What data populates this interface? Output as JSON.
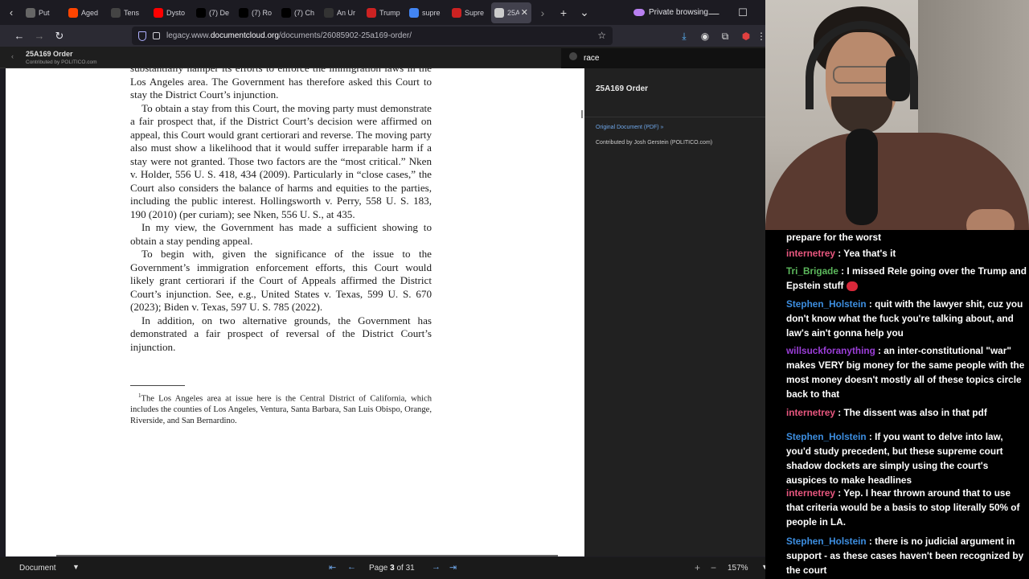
{
  "browser": {
    "tabs": [
      {
        "label": "Put",
        "icon": "generic-tab-icon",
        "color": "#666666"
      },
      {
        "label": "Aged",
        "icon": "reddit-icon",
        "color": "#ff4500"
      },
      {
        "label": "Tens",
        "icon": "generic-tab-icon",
        "color": "#444444"
      },
      {
        "label": "Dysto",
        "icon": "youtube-icon",
        "color": "#ff0000"
      },
      {
        "label": "(7) De",
        "icon": "x-icon",
        "color": "#000000"
      },
      {
        "label": "(7) Ro",
        "icon": "x-icon",
        "color": "#000000"
      },
      {
        "label": "(7) Ch",
        "icon": "x-icon",
        "color": "#000000"
      },
      {
        "label": "An Ur",
        "icon": "generic-tab-icon",
        "color": "#333333"
      },
      {
        "label": "Trump",
        "icon": "generic-tab-icon",
        "color": "#cc2222"
      },
      {
        "label": "supre",
        "icon": "google-icon",
        "color": "#4285f4"
      },
      {
        "label": "Supre",
        "icon": "generic-tab-icon",
        "color": "#cc2222"
      },
      {
        "label": "25A",
        "icon": "documentcloud-icon",
        "color": "#cccccc"
      }
    ],
    "private_label": "Private browsing",
    "url_prefix": "legacy.www.",
    "url_domain": "documentcloud.org",
    "url_path": "/documents/26085902-25a169-order/"
  },
  "viewer": {
    "header_title": "25A169 Order",
    "header_contrib": "Contributed by POLITICO.com",
    "search_query": "race",
    "side_title": "25A169 Order",
    "original_link": "Original Document (PDF) »",
    "contributed_by": "Contributed by Josh Gerstein (POLITICO.com)",
    "page_label": "Page",
    "page_current": "3",
    "page_total": "of 31",
    "mode": "Document",
    "zoom": "157%"
  },
  "document": {
    "p0": "substantially hamper its efforts to enforce the immigration laws in the Los Angeles area. The Government has therefore asked this Court to stay the District Court’s injunction.",
    "p1": "To obtain a stay from this Court, the moving party must demonstrate a fair prospect that, if the District Court’s decision were affirmed on appeal, this Court would grant certiorari and reverse. The moving party also must show a likelihood that it would suffer irreparable harm if a stay were not granted. Those two factors are the “most critical.” Nken v. Holder, 556 U. S. 418, 434 (2009). Particularly in “close cases,” the Court also considers the balance of harms and equities to the parties, including the public interest. Hollingsworth v. Perry, 558 U. S. 183, 190 (2010) (per curiam); see Nken, 556 U. S., at 435.",
    "p2": "In my view, the Government has made a sufficient showing to obtain a stay pending appeal.",
    "p3": "To begin with, given the significance of the issue to the Government’s immigration enforcement efforts, this Court would likely grant certiorari if the Court of Appeals affirmed the District Court’s injunction. See, e.g., United States v. Texas, 599 U. S. 670 (2023); Biden v. Texas, 597 U. S. 785 (2022).",
    "p4": "In addition, on two alternative grounds, the Government has demonstrated a fair prospect of reversal of the District Court’s injunction.",
    "fn_mark": "1",
    "footnote": "The Los Angeles area at issue here is the Central District of California, which includes the counties of Los Angeles, Ventura, Santa Barbara, San Luis Obispo, Orange, Riverside, and San Bernardino."
  },
  "chat": [
    {
      "user": "",
      "color": "#ffffff",
      "text": "prepare for the worst"
    },
    {
      "user": "internetrey",
      "color": "#e8577f",
      "text": "Yea that's it"
    },
    {
      "user": "Tri_Brigade",
      "color": "#5cb85c",
      "text": "I missed Rele going over the Trump and Epstein stuff"
    },
    {
      "user": "Stephen_Holstein",
      "color": "#3d8ee0",
      "text": "quit with the lawyer shit, cuz you don't know what the fuck you're talking about, and law's ain't gonna help you"
    },
    {
      "user": "willsuckforanything",
      "color": "#9b3ed8",
      "text": "an inter-constitutional \"war\" makes VERY big money for the same people with the most money doesn't mostly all of these topics circle back to that"
    },
    {
      "user": "internetrey",
      "color": "#e8577f",
      "text": "The dissent was also in that pdf"
    },
    {
      "user": "Stephen_Holstein",
      "color": "#3d8ee0",
      "text": "If you want to delve into law, you'd study precedent, but these supreme court shadow dockets are simply using the court's auspices to make headlines"
    },
    {
      "user": "internetrey",
      "color": "#e8577f",
      "text": "Yep. I hear thrown around that to use that criteria would be a basis to stop literally 50% of people in LA."
    },
    {
      "user": "Stephen_Holstein",
      "color": "#3d8ee0",
      "text": "there is no judicial argument in support - as these cases haven't been recognized by the court"
    }
  ]
}
